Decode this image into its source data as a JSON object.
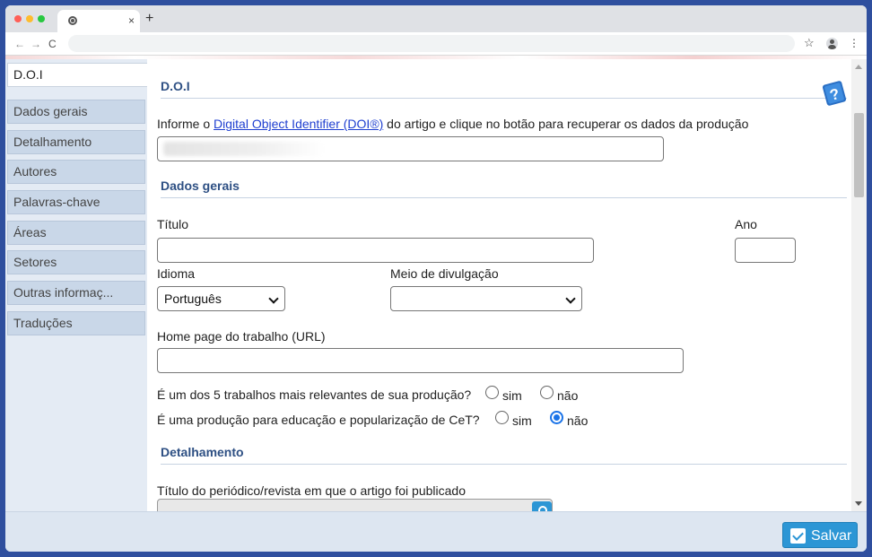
{
  "browser": {
    "tab_close": "×",
    "new_tab": "+",
    "back": "←",
    "forward": "→",
    "reload": "C",
    "star": "☆",
    "menu": "⋮"
  },
  "sidebar": {
    "items": [
      {
        "label": "D.O.I",
        "active": true
      },
      {
        "label": "Dados gerais"
      },
      {
        "label": "Detalhamento"
      },
      {
        "label": "Autores"
      },
      {
        "label": "Palavras-chave"
      },
      {
        "label": "Áreas"
      },
      {
        "label": "Setores"
      },
      {
        "label": "Outras informaç..."
      },
      {
        "label": "Traduções"
      }
    ]
  },
  "doi": {
    "section_title": "D.O.I",
    "intro_before": "Informe o ",
    "intro_link": "Digital Object Identifier (DOI®)",
    "intro_after": " do artigo e clique no botão para recuperar os dados da produção"
  },
  "dados_gerais": {
    "section_title": "Dados gerais",
    "titulo_label": "Título",
    "ano_label": "Ano",
    "idioma_label": "Idioma",
    "idioma_value": "Português",
    "meio_label": "Meio de divulgação",
    "meio_value": "",
    "homepage_label": "Home page do trabalho (URL)",
    "relevantes_question": "É um dos 5 trabalhos mais relevantes de sua produção?",
    "relevantes_selected": "none",
    "popularizacao_question": "É uma produção para educação e popularização de CeT?",
    "popularizacao_selected": "não",
    "sim_label": "sim",
    "nao_label": "não"
  },
  "detalhamento": {
    "section_title": "Detalhamento",
    "periodico_label": "Título do periódico/revista em que o artigo foi publicado"
  },
  "footer": {
    "save_label": "Salvar"
  },
  "colors": {
    "accent": "#2c96d5",
    "section_title": "#2d4f83",
    "sidebar_tab": "#c9d7e8",
    "page_background": "#2f4f9e"
  }
}
